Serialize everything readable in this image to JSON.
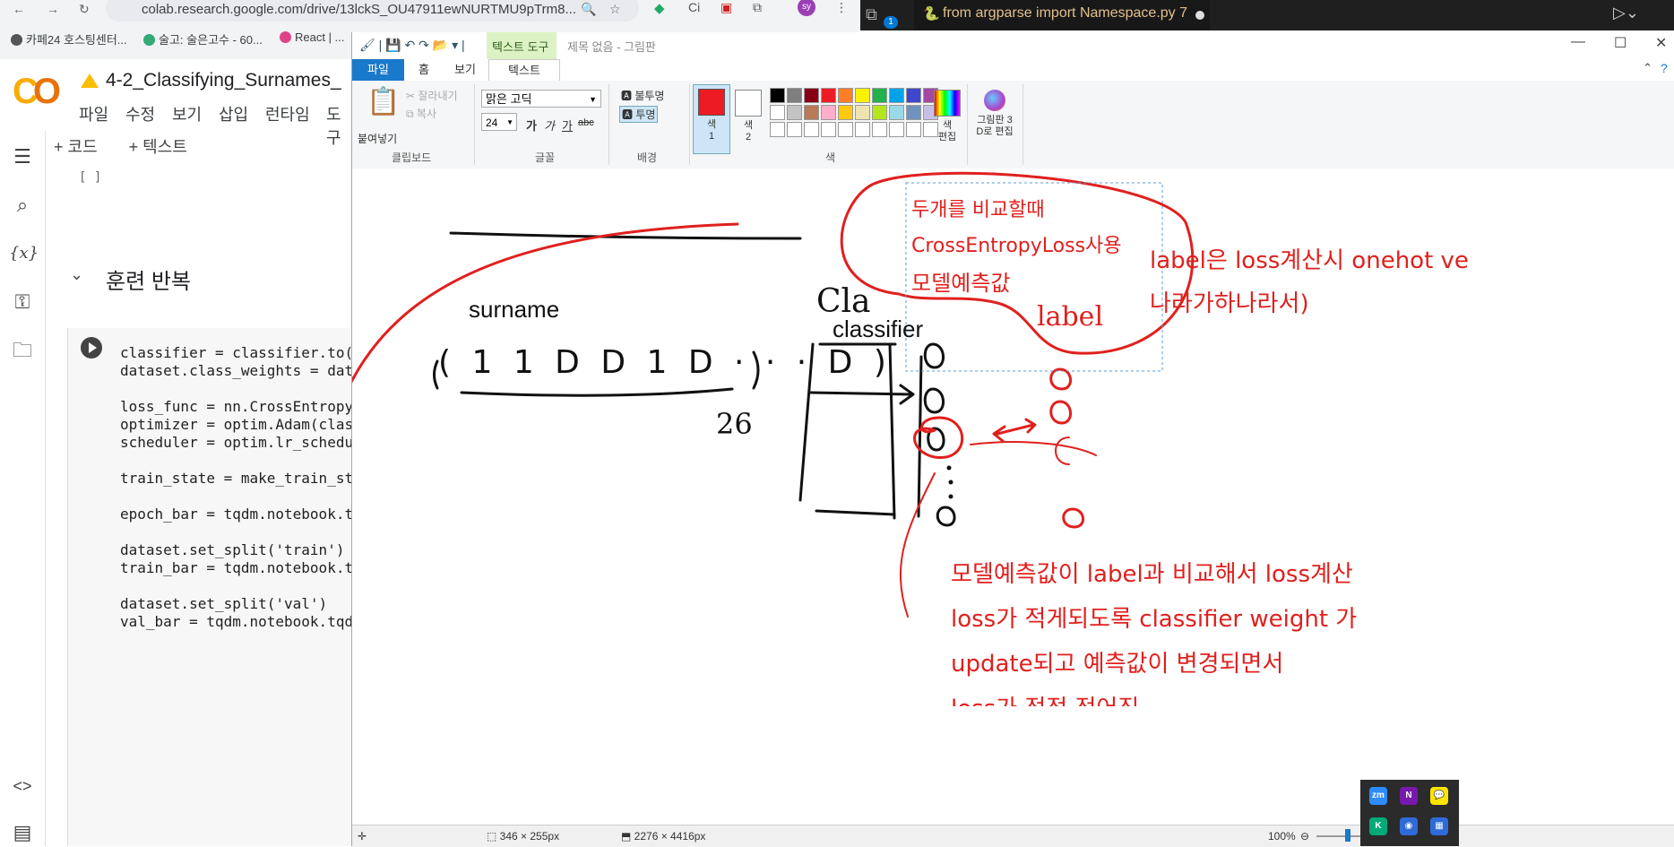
{
  "browser": {
    "url": "colab.research.google.com/drive/13lckS_OU47911ewNURTMU9pTrm8...",
    "bookmarks": [
      "카페24 호스팅센터...",
      "술고: 술은고수 - 60...",
      "React | ..."
    ]
  },
  "colab": {
    "logo": "CO",
    "title": "4-2_Classifying_Surnames_",
    "menu": [
      "파일",
      "수정",
      "보기",
      "삽입",
      "런타임",
      "도구"
    ],
    "toolbar": {
      "add_code": "+ 코드",
      "add_text": "+ 텍스트"
    },
    "empty_cell": "[ ]",
    "section_title": "훈련 반복",
    "code_lines": [
      "classifier = classifier.to(ar",
      "dataset.class_weights = datas",
      "",
      "loss_func = nn.CrossEntropyLo",
      "optimizer = optim.Adam(classi",
      "scheduler = optim.lr_schedule",
      "",
      "train_state = make_train_stat",
      "",
      "epoch_bar = tqdm.notebook.tqd",
      "",
      "dataset.set_split('train')",
      "train_bar = tqdm.notebook.tqd",
      "",
      "dataset.set_split('val')",
      "val_bar = tqdm.notebook.tqdm("
    ]
  },
  "vscode": {
    "tab_label": "from argparse import Namespace.py 7",
    "badge": "1"
  },
  "paint": {
    "context_tab": "텍스트 도구",
    "window_title": "제목 없음 - 그림판",
    "tabs": [
      "파일",
      "홈",
      "보기",
      "텍스트"
    ],
    "clipboard": {
      "paste": "붙여넣기",
      "cut": "잘라내기",
      "copy": "복사",
      "group": "클립보드"
    },
    "font": {
      "family": "맑은 고딕",
      "size": "24",
      "bold": "가",
      "italic": "가",
      "underline": "가",
      "strike": "abc",
      "group": "글꼴"
    },
    "background": {
      "opaque": "불투명",
      "transparent": "투명",
      "group": "배경"
    },
    "colors": {
      "color1": "색\n1",
      "color2": "색\n2",
      "edit": "색\n편집",
      "paint3d": "그림판 3\nD로 편집",
      "group": "색",
      "color1_hex": "#ed1c24"
    },
    "palette_row1": [
      "#000000",
      "#7f7f7f",
      "#880015",
      "#ed1c24",
      "#ff7f27",
      "#fff200",
      "#22b14c",
      "#00a2e8",
      "#3f48cc",
      "#a349a4"
    ],
    "palette_row2": [
      "#ffffff",
      "#c3c3c3",
      "#b97a57",
      "#ffaec9",
      "#ffc90e",
      "#efe4b0",
      "#b5e61d",
      "#99d9ea",
      "#7092be",
      "#c8bfe7"
    ],
    "status": {
      "selection": "346 × 255px",
      "canvas": "2276 × 4416px",
      "zoom": "100%"
    },
    "drawing": {
      "surname": "surname",
      "vector": "( 1 1 D D 1 D · · · D )",
      "num": "26",
      "cla": "Cla",
      "classifier": "classifier",
      "label_hand": "label",
      "box_line1": "두개를 비교할때",
      "box_line2": "CrossEntropyLoss사용",
      "box_line3": "모델예측값",
      "note_r1": "label은 loss계산시 onehot ve",
      "note_r2": "나라가하나라서)",
      "bottom1": "모델예측값이 label과 비교해서 loss계산",
      "bottom2": "loss가 적게되도록 classifier weight 가",
      "bottom3": "update되고 예측값이 변경되면서",
      "bottom4": "loss가 점점 적어짐"
    }
  },
  "tray": [
    "zm",
    "N",
    "💬",
    "K",
    "◉",
    "▦"
  ]
}
